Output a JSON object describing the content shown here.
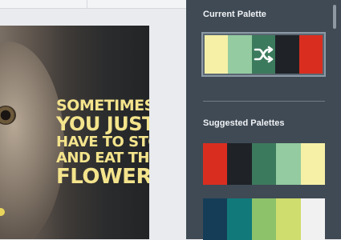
{
  "poster": {
    "lines": [
      "SOMETIMES",
      "YOU JUST",
      "HAVE TO STOP",
      "AND EAT THE",
      "FLOWERS"
    ]
  },
  "panel": {
    "current_title": "Current Palette",
    "suggested_title": "Suggested Palettes"
  },
  "current_palette": [
    "#f5f0a6",
    "#94cba0",
    "#3c7a5d",
    "#1f2328",
    "#d92e1f"
  ],
  "suggested_palettes": [
    [
      "#d92e1f",
      "#1f2328",
      "#3c7a5d",
      "#94cba0",
      "#f5f0a6"
    ],
    [
      "#153d57",
      "#12797a",
      "#8dc26a",
      "#cfdd6e",
      "#f1f1f1"
    ]
  ],
  "icons": {
    "shuffle": "shuffle-icon"
  }
}
